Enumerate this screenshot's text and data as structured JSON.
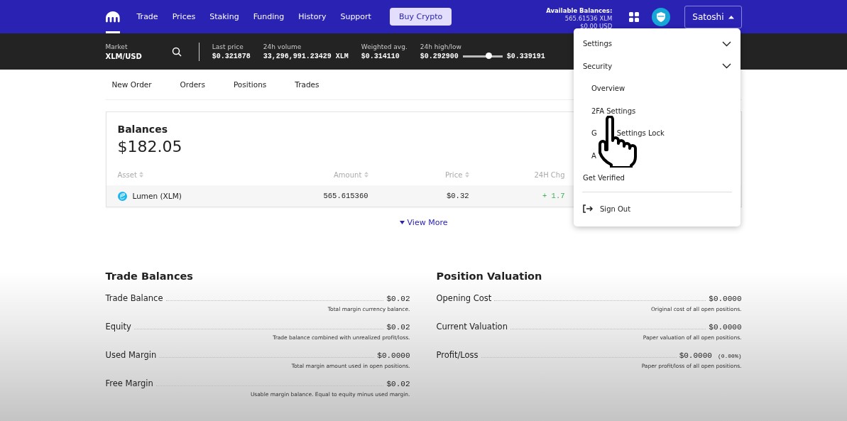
{
  "nav": {
    "logo_selected": true,
    "links": [
      {
        "label": "Trade"
      },
      {
        "label": "Prices"
      },
      {
        "label": "Staking"
      },
      {
        "label": "Funding"
      },
      {
        "label": "History"
      },
      {
        "label": "Support"
      }
    ],
    "buy_button": "Buy Crypto",
    "available": {
      "title": "Available Balances:",
      "lines": [
        "565.61536 XLM",
        "$0.00 USD"
      ]
    },
    "user_button": {
      "label": "Satoshi",
      "expanded": true
    }
  },
  "market_bar": {
    "market_label": "Market",
    "market": "XLM/USD",
    "stats": [
      {
        "label": "Last price",
        "value": "$0.321878"
      },
      {
        "label": "24h volume",
        "value": "33,296,991.23429 XLM"
      },
      {
        "label": "Weighted avg.",
        "value": "$0.314110"
      }
    ],
    "high_low": {
      "label": "24h high/low",
      "low": "$0.292900",
      "high": "$0.339191",
      "level": 0.64
    }
  },
  "subtabs": [
    {
      "label": "New Order"
    },
    {
      "label": "Orders"
    },
    {
      "label": "Positions"
    },
    {
      "label": "Trades"
    }
  ],
  "balances": {
    "title": "Balances",
    "total": "$182.05",
    "columns": [
      "Asset",
      "Amount",
      "Price",
      "24H Chg"
    ],
    "rows": [
      {
        "asset": "Lumen (XLM)",
        "amount": "565.615360",
        "price": "$0.32",
        "change": "+ 1.7"
      }
    ],
    "view_more": "View More"
  },
  "trade_balances": {
    "title": "Trade Balances",
    "items": [
      {
        "label": "Trade Balance",
        "value": "$0.02",
        "note": "Total margin currency balance."
      },
      {
        "label": "Equity",
        "value": "$0.02",
        "note": "Trade balance combined with unrealized profit/loss."
      },
      {
        "label": "Used Margin",
        "value": "$0.0000",
        "note": "Total margin amount used in open positions."
      },
      {
        "label": "Free Margin",
        "value": "$0.02",
        "note": "Usable margin balance. Equal to equity minus used margin."
      }
    ]
  },
  "position_valuation": {
    "title": "Position Valuation",
    "items": [
      {
        "label": "Opening Cost",
        "value": "$0.0000",
        "note": "Original cost of all open positions."
      },
      {
        "label": "Current Valuation",
        "value": "$0.0000",
        "note": "Paper valuation of all open positions."
      },
      {
        "label": "Profit/Loss",
        "value": "$0.0000",
        "extra": "(0.00%)",
        "note": "Paper profit/loss of all open positions."
      }
    ]
  },
  "menu": {
    "items": [
      {
        "kind": "section",
        "label": "Settings"
      },
      {
        "kind": "section",
        "label": "Security"
      },
      {
        "kind": "sub",
        "label": "Overview"
      },
      {
        "kind": "sub",
        "label": "2FA Settings"
      },
      {
        "kind": "split",
        "start": "G",
        "end": "Settings Lock"
      },
      {
        "kind": "sub",
        "label": "A"
      },
      {
        "kind": "link",
        "label": "Get Verified"
      },
      {
        "kind": "signout",
        "label": "Sign Out"
      }
    ]
  }
}
